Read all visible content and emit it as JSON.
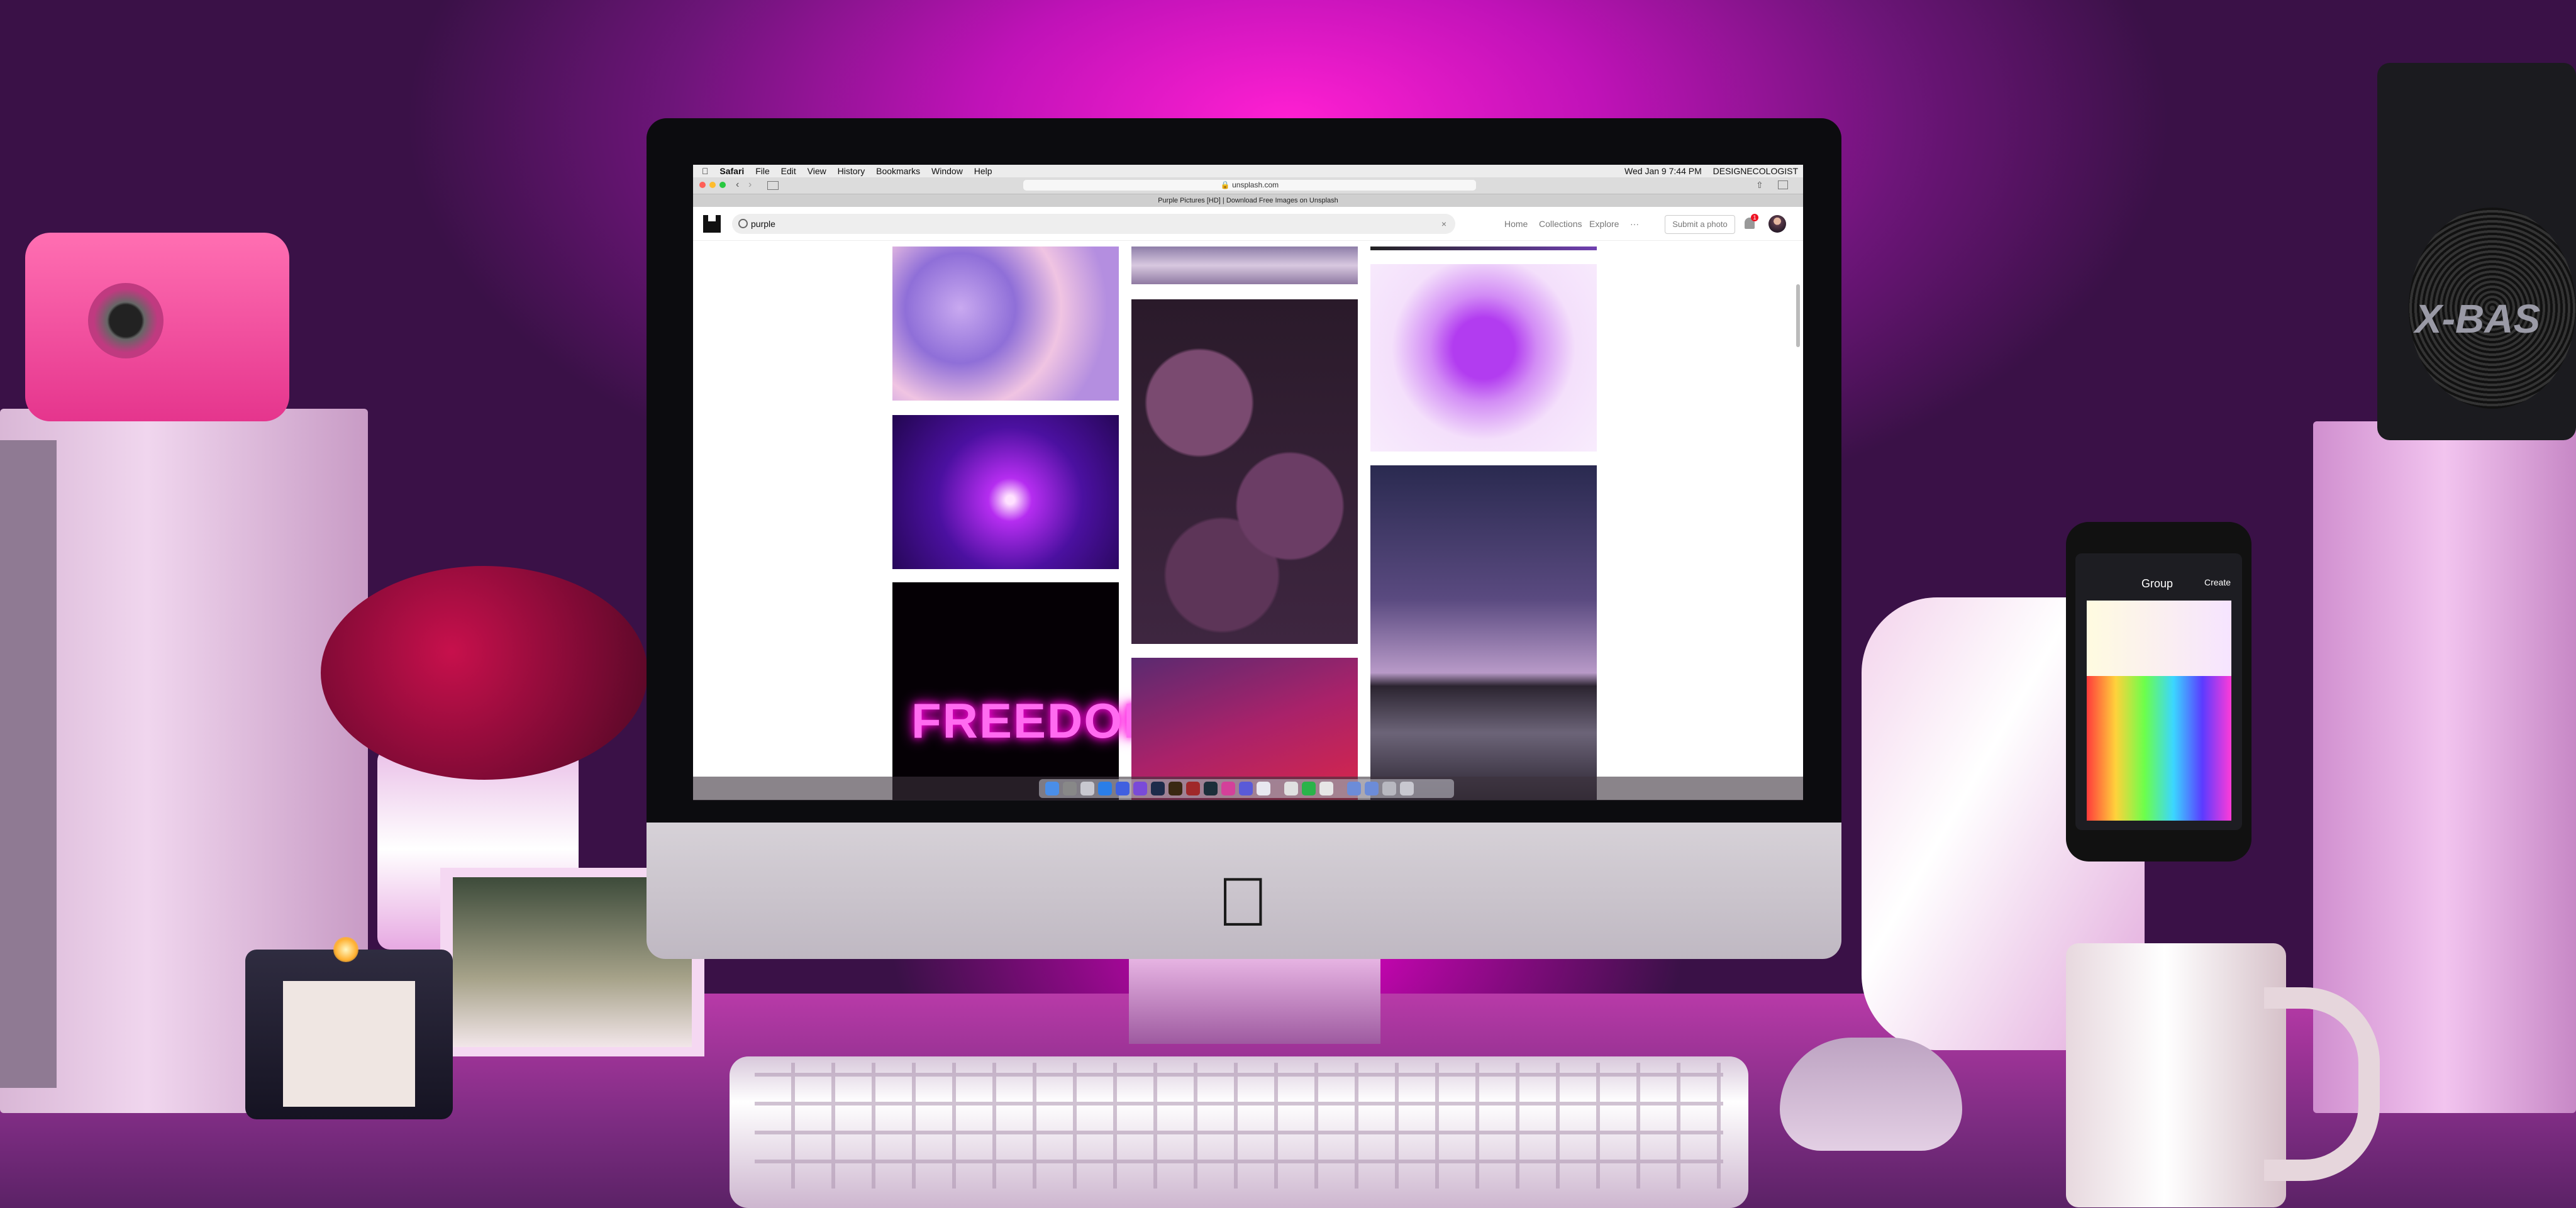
{
  "scene": {
    "speaker_brand": "X-BAS"
  },
  "menubar": {
    "app": "Safari",
    "items": [
      "File",
      "Edit",
      "View",
      "History",
      "Bookmarks",
      "Window",
      "Help"
    ],
    "clock": "Wed Jan 9 7:44 PM",
    "user": "DESIGNECOLOGIST"
  },
  "browser": {
    "url": "unsplash.com",
    "tab_title": "Purple Pictures [HD] | Download Free Images on Unsplash"
  },
  "header": {
    "search_value": "purple",
    "clear_label": "×",
    "nav": [
      "Home",
      "Collections",
      "Explore",
      "···"
    ],
    "submit_label": "Submit a photo",
    "notification_count": "1"
  },
  "photos": {
    "freedom_text": "FREEDOM"
  },
  "phone": {
    "title": "Group",
    "action": "Create"
  },
  "colors": {
    "accent": "#ff1fd2",
    "screen_bg": "#ffffff"
  },
  "icons": [
    "apple-icon",
    "search-icon",
    "clear-icon",
    "bell-icon",
    "avatar",
    "back-icon",
    "forward-icon",
    "share-icon"
  ]
}
